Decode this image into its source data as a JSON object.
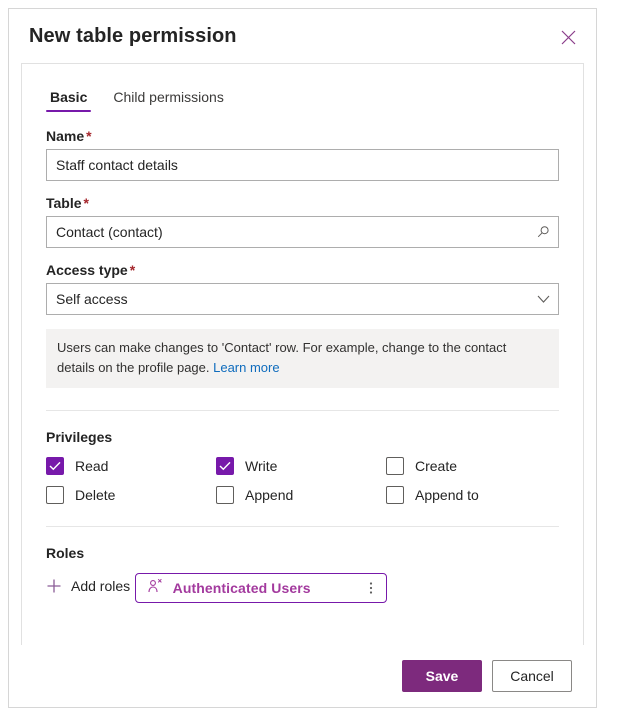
{
  "panel": {
    "title": "New table permission",
    "close_label": "Close"
  },
  "tabs": [
    {
      "label": "Basic",
      "active": true
    },
    {
      "label": "Child permissions",
      "active": false
    }
  ],
  "fields": {
    "name": {
      "label": "Name",
      "required_marker": "*",
      "value": "Staff contact details",
      "placeholder": ""
    },
    "table": {
      "label": "Table",
      "required_marker": "*",
      "value": "Contact (contact)",
      "placeholder": "",
      "icon": "search-icon"
    },
    "access_type": {
      "label": "Access type",
      "required_marker": "*",
      "value": "Self access",
      "icon": "chevron-down-icon"
    }
  },
  "info": {
    "text": "Users can make changes to 'Contact' row. For example, change to the contact details on the profile page. ",
    "link_label": "Learn more"
  },
  "privileges": {
    "title": "Privileges",
    "items": [
      {
        "label": "Read",
        "checked": true
      },
      {
        "label": "Write",
        "checked": true
      },
      {
        "label": "Create",
        "checked": false
      },
      {
        "label": "Delete",
        "checked": false
      },
      {
        "label": "Append",
        "checked": false
      },
      {
        "label": "Append to",
        "checked": false
      }
    ]
  },
  "roles": {
    "title": "Roles",
    "add_label": "Add roles",
    "add_icon": "plus-icon",
    "items": [
      {
        "label": "Authenticated Users",
        "icon": "web-role-person-icon",
        "more_icon": "more-vertical-icon"
      }
    ]
  },
  "footer": {
    "save_label": "Save",
    "cancel_label": "Cancel"
  },
  "colors": {
    "accent_purple": "#7719aa",
    "save_purple": "#7d2a7d",
    "role_text": "#a33a9e",
    "required_red": "#a4262c",
    "link_blue": "#0f6cbd",
    "info_bg": "#f3f2f1"
  }
}
